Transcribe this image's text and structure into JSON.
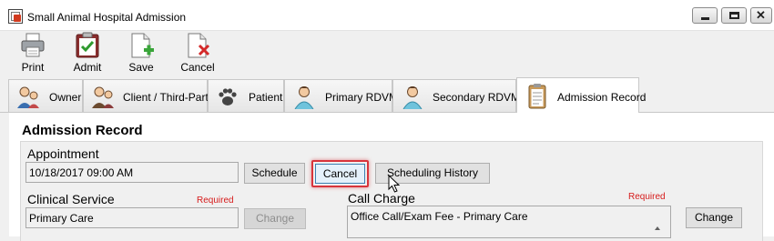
{
  "window": {
    "title": "Small Animal Hospital Admission"
  },
  "toolbar": {
    "print": "Print",
    "admit": "Admit",
    "save": "Save",
    "cancel": "Cancel"
  },
  "tabs": [
    {
      "label": "Owner"
    },
    {
      "label": "Client / Third-Party"
    },
    {
      "label": "Patient"
    },
    {
      "label": "Primary RDVM"
    },
    {
      "label": "Secondary RDVM"
    },
    {
      "label": "Admission Record"
    }
  ],
  "section": {
    "title": "Admission Record"
  },
  "appointment": {
    "label": "Appointment",
    "value": "10/18/2017 09:00 AM",
    "schedule_btn": "Schedule",
    "cancel_btn": "Cancel",
    "history_btn": "Scheduling History"
  },
  "clinical_service": {
    "label": "Clinical Service",
    "required": "Required",
    "value": "Primary Care",
    "change_btn": "Change"
  },
  "call_charge": {
    "label": "Call Charge",
    "required": "Required",
    "value": "Office Call/Exam Fee - Primary Care",
    "change_btn": "Change"
  },
  "colors": {
    "highlight": "#d8343c",
    "required": "#d61b1b"
  }
}
